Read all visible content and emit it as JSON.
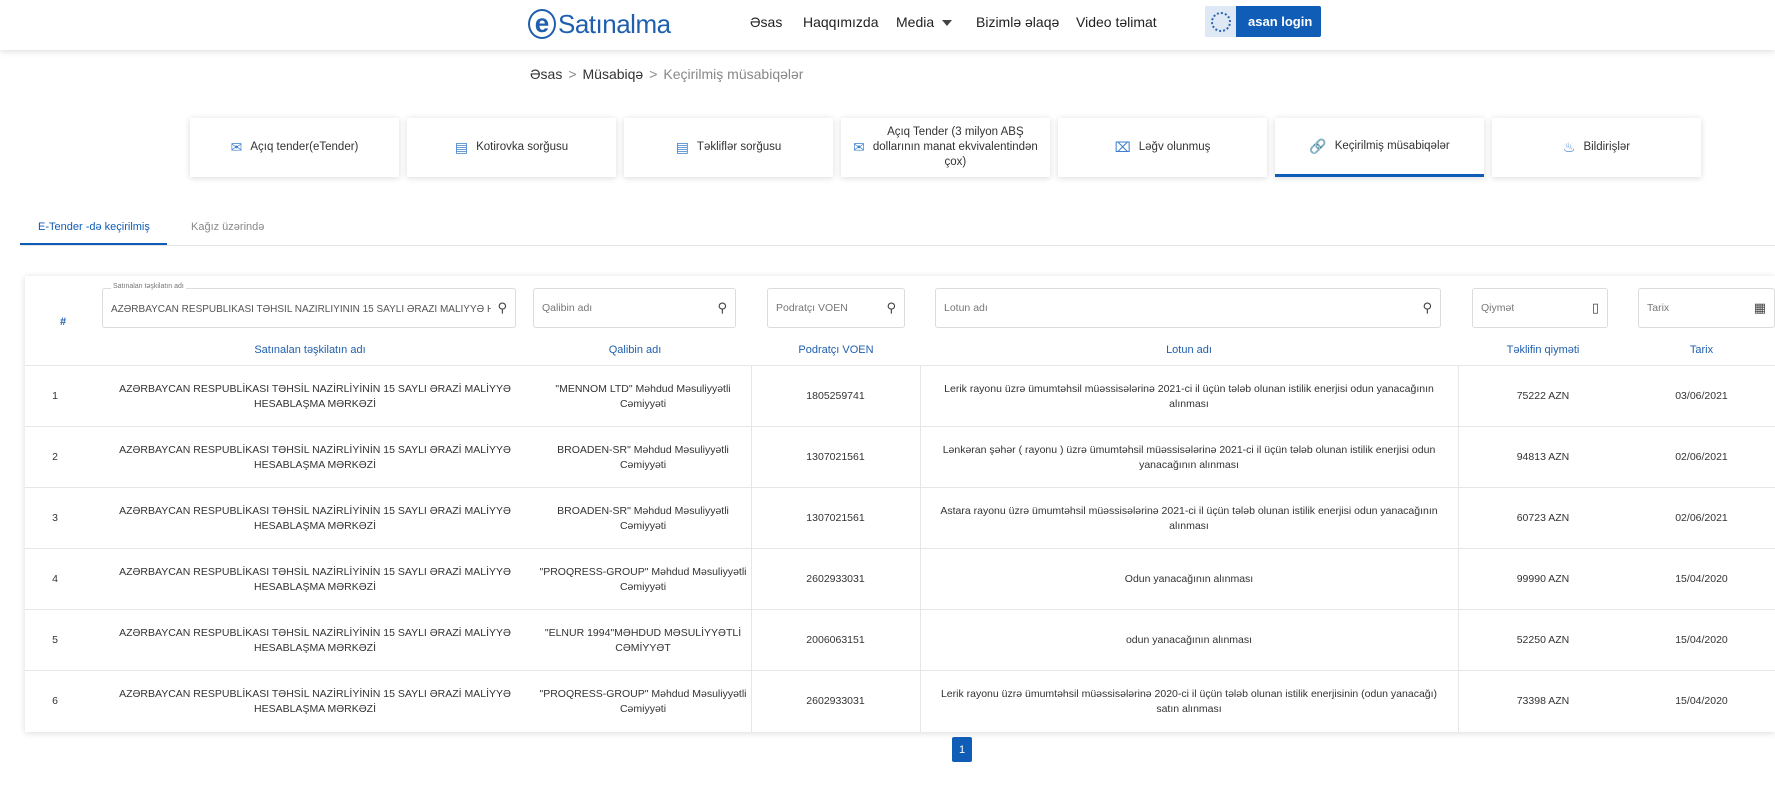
{
  "header": {
    "logo_text": "Satınalma",
    "nav": [
      "Əsas",
      "Haqqımızda",
      "Media",
      "Bizimlə əlaqə",
      "Video təlimat"
    ],
    "login_label": "asan login"
  },
  "breadcrumb": {
    "home": "Əsas",
    "section": "Müsabiqə",
    "current": "Keçirilmiş müsabiqələr"
  },
  "cards": [
    {
      "label": "Açıq tender(eTender)",
      "icon": "envelope-icon"
    },
    {
      "label": "Kotirovka sorğusu",
      "icon": "chat-icon"
    },
    {
      "label": "Təkliflər sorğusu",
      "icon": "chat-icon"
    },
    {
      "label": "Açıq Tender (3 milyon ABŞ dollarının manat ekvivalentindən çox)",
      "icon": "envelope-icon"
    },
    {
      "label": "Ləğv olunmuş",
      "icon": "close-icon"
    },
    {
      "label": "Keçirilmiş müsabiqələr",
      "icon": "link-icon"
    },
    {
      "label": "Bildirişlər",
      "icon": "bell-icon"
    }
  ],
  "subtabs": [
    "E-Tender -də keçirilmiş",
    "Kağız üzərində"
  ],
  "filters": {
    "org_label": "Satınalan təşkilatın adı",
    "org_value": "AZƏRBAYCAN RESPUBLİKASI TƏHSİL NAZİRLİYİNİN 15 SAYLI ƏRAZİ MALİYYƏ H",
    "winner_ph": "Qalibin adı",
    "voen_ph": "Podratçı VOEN",
    "lot_ph": "Lotun adı",
    "price_ph": "Qiymət",
    "date_ph": "Tarix"
  },
  "table": {
    "hash": "#",
    "headers": [
      "Satınalan təşkilatın adı",
      "Qalibin adı",
      "Podratçı VOEN",
      "Lotun adı",
      "Təklifin qiyməti",
      "Tarix"
    ],
    "rows": [
      {
        "n": "1",
        "org": "AZƏRBAYCAN RESPUBLİKASI TƏHSİL NAZİRLİYİNİN 15 SAYLI ƏRAZİ MALİYYƏ HESABLAŞMA MƏRKƏZİ",
        "winner": "\"MENNOM LTD\" Məhdud Məsuliyyətli Cəmiyyəti",
        "voen": "1805259741",
        "lot": "Lerik rayonu üzrə ümumtəhsil müəssisələrinə 2021-ci il üçün tələb olunan istilik enerjisi odun yanacağının alınması",
        "price": "75222 AZN",
        "date": "03/06/2021"
      },
      {
        "n": "2",
        "org": "AZƏRBAYCAN RESPUBLİKASI TƏHSİL NAZİRLİYİNİN 15 SAYLI ƏRAZİ MALİYYƏ HESABLAŞMA MƏRKƏZİ",
        "winner": "BROADEN-SR\" Məhdud Məsuliyyətli Cəmiyyəti",
        "voen": "1307021561",
        "lot": "Lənkəran şəhər ( rayonu ) üzrə ümumtəhsil müəssisələrinə 2021-ci il üçün tələb olunan istilik enerjisi odun yanacağının alınması",
        "price": "94813 AZN",
        "date": "02/06/2021"
      },
      {
        "n": "3",
        "org": "AZƏRBAYCAN RESPUBLİKASI TƏHSİL NAZİRLİYİNİN 15 SAYLI ƏRAZİ MALİYYƏ HESABLAŞMA MƏRKƏZİ",
        "winner": "BROADEN-SR\" Məhdud Məsuliyyətli Cəmiyyəti",
        "voen": "1307021561",
        "lot": "Astara rayonu üzrə ümumtəhsil müəssisələrinə 2021-ci il üçün tələb olunan istilik enerjisi odun yanacağının alınması",
        "price": "60723 AZN",
        "date": "02/06/2021"
      },
      {
        "n": "4",
        "org": "AZƏRBAYCAN RESPUBLİKASI TƏHSİL NAZİRLİYİNİN 15 SAYLI ƏRAZİ MALİYYƏ HESABLAŞMA MƏRKƏZİ",
        "winner": "\"PROQRESS-GROUP\" Məhdud Məsuliyyətli Cəmiyyəti",
        "voen": "2602933031",
        "lot": "Odun yanacağının alınması",
        "price": "99990 AZN",
        "date": "15/04/2020"
      },
      {
        "n": "5",
        "org": "AZƏRBAYCAN RESPUBLİKASI TƏHSİL NAZİRLİYİNİN 15 SAYLI ƏRAZİ MALİYYƏ HESABLAŞMA MƏRKƏZİ",
        "winner": "\"ELNUR 1994\"MƏHDUD MƏSULİYYƏTLİ CƏMİYYƏT",
        "voen": "2006063151",
        "lot": "odun yanacağının alınması",
        "price": "52250 AZN",
        "date": "15/04/2020"
      },
      {
        "n": "6",
        "org": "AZƏRBAYCAN RESPUBLİKASI TƏHSİL NAZİRLİYİNİN 15 SAYLI ƏRAZİ MALİYYƏ HESABLAŞMA MƏRKƏZİ",
        "winner": "\"PROQRESS-GROUP\" Məhdud Məsuliyyətli Cəmiyyəti",
        "voen": "2602933031",
        "lot": "Lerik rayonu üzrə ümumtəhsil müəssisələrinə 2020-ci il üçün tələb olunan istilik enerjisinin (odun yanacağı) satın alınması",
        "price": "73398 AZN",
        "date": "15/04/2020"
      }
    ]
  },
  "pagination": {
    "current": "1"
  },
  "colors": {
    "accent": "#0f5db6",
    "header_text": "#1f5fae"
  }
}
